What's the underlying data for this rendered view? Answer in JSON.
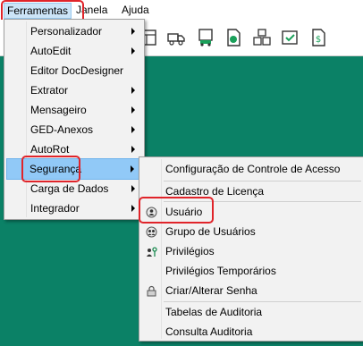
{
  "menubar": {
    "items": [
      "Ferramentas",
      "Janela",
      "Ajuda"
    ]
  },
  "toolbar": {
    "icons": [
      "table-icon",
      "truck-icon",
      "truck-doc-icon",
      "money-doc-icon",
      "boxes-icon",
      "checklist-icon",
      "dollar-doc-icon"
    ]
  },
  "ferramentas_menu": {
    "items": [
      {
        "label": "Personalizador",
        "submenu": true
      },
      {
        "label": "AutoEdit",
        "submenu": true
      },
      {
        "label": "Editor DocDesigner",
        "submenu": false
      },
      {
        "label": "Extrator",
        "submenu": true
      },
      {
        "label": "Mensageiro",
        "submenu": true
      },
      {
        "label": "GED-Anexos",
        "submenu": true
      },
      {
        "label": "AutoRot",
        "submenu": true
      },
      {
        "label": "Segurança",
        "submenu": true
      },
      {
        "label": "Carga de Dados",
        "submenu": true
      },
      {
        "label": "Integrador",
        "submenu": true
      }
    ]
  },
  "seguranca_menu": {
    "items": [
      "Configuração de Controle de Acesso",
      "Cadastro de Licença",
      "Usuário",
      "Grupo de Usuários",
      "Privilégios",
      "Privilégios Temporários",
      "Criar/Alterar Senha",
      "Tabelas de Auditoria",
      "Consulta Auditoria"
    ]
  },
  "colors": {
    "background": "#0b8166",
    "highlight": "#91c9f7",
    "annotation_red": "#e0242a"
  }
}
